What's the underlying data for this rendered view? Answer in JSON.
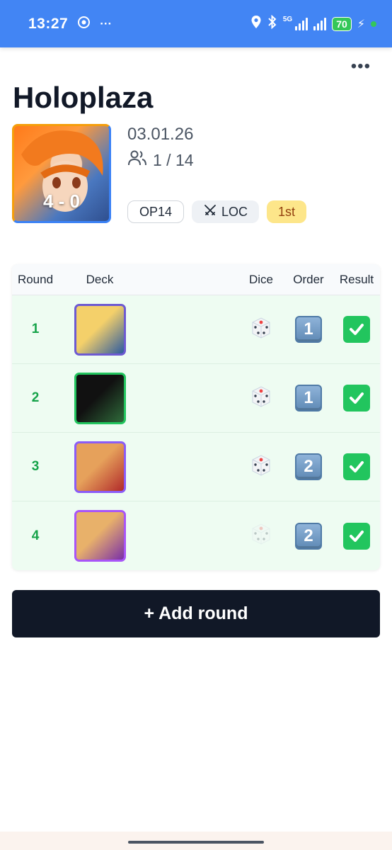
{
  "status_bar": {
    "time": "13:27",
    "network": "5G",
    "battery": "70"
  },
  "header": {
    "title": "Holoplaza"
  },
  "event": {
    "score": "4 - 0",
    "date": "03.01.26",
    "players": "1 / 14",
    "tags": {
      "set": "OP14",
      "format": "LOC",
      "placement": "1st"
    }
  },
  "table": {
    "headers": {
      "round": "Round",
      "deck": "Deck",
      "dice": "Dice",
      "order": "Order",
      "result": "Result"
    },
    "rows": [
      {
        "round": "1",
        "deck_border": "#6d5ad1",
        "deck_colors": [
          "#f4d06a",
          "#2c5aa0"
        ],
        "dice_won": true,
        "order": "1",
        "result": "win"
      },
      {
        "round": "2",
        "deck_border": "#22c55e",
        "deck_colors": [
          "#111111",
          "#2f6b3a"
        ],
        "dice_won": true,
        "order": "1",
        "result": "win"
      },
      {
        "round": "3",
        "deck_border": "#8b5cf6",
        "deck_colors": [
          "#e6a15b",
          "#b12a2a"
        ],
        "dice_won": true,
        "order": "2",
        "result": "win"
      },
      {
        "round": "4",
        "deck_border": "#a855f7",
        "deck_colors": [
          "#e8b16a",
          "#7a2fa8"
        ],
        "dice_won": false,
        "order": "2",
        "result": "win"
      }
    ]
  },
  "actions": {
    "add_round": "+ Add round"
  },
  "colors": {
    "status_bar": "#4285f4",
    "row_bg": "#eefcf2",
    "round_number": "#16a34a",
    "primary_button": "#111827",
    "placement_tag": "#fde68a"
  }
}
